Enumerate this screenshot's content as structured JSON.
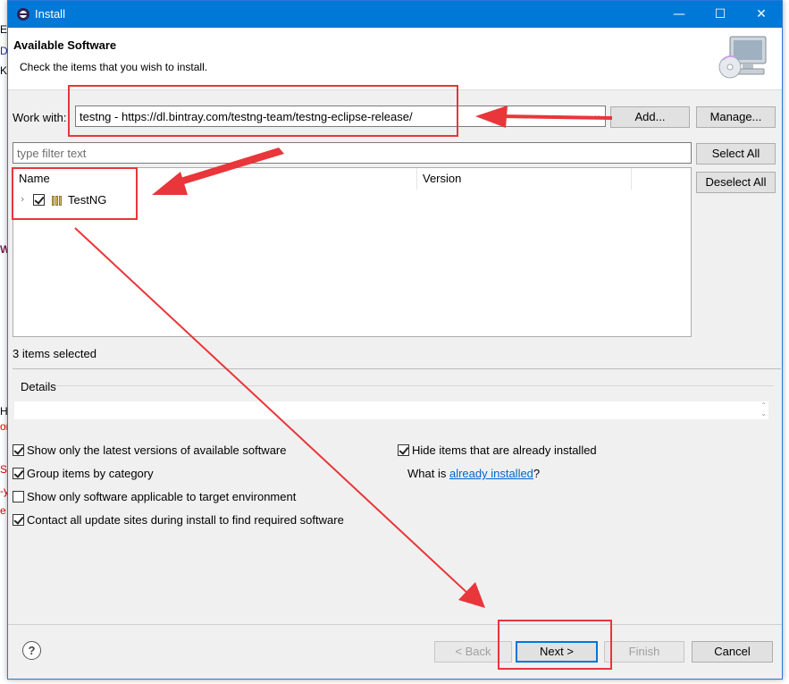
{
  "window": {
    "title": "Install",
    "controls": {
      "minimize": "—",
      "maximize": "☐",
      "close": "✕"
    }
  },
  "banner": {
    "heading": "Available Software",
    "description": "Check the items that you wish to install."
  },
  "work_with": {
    "label": "Work with:",
    "value": "testng - https://dl.bintray.com/testng-team/testng-eclipse-release/",
    "dropdown_glyph": "⌄",
    "add_button": "Add...",
    "manage_button": "Manage..."
  },
  "filter": {
    "placeholder": "type filter text",
    "value": ""
  },
  "side_buttons": {
    "select_all": "Select All",
    "deselect_all": "Deselect All"
  },
  "tree": {
    "columns": [
      "Name",
      "Version"
    ],
    "rows": [
      {
        "expander": "›",
        "checked": true,
        "name": "TestNG",
        "version": ""
      }
    ]
  },
  "status": {
    "selection_count": "3 items selected"
  },
  "details": {
    "label": "Details",
    "text": "",
    "scroll_up": "⌃",
    "scroll_down": "⌄"
  },
  "options": [
    {
      "label": "Show only the latest versions of available software",
      "checked": true
    },
    {
      "label": "Group items by category",
      "checked": true
    },
    {
      "label": "Show only software applicable to target environment",
      "checked": false
    },
    {
      "label": "Contact all update sites during install to find required software",
      "checked": true
    },
    {
      "label": "Hide items that are already installed",
      "checked": true
    }
  ],
  "already_installed": {
    "prefix": "What is ",
    "link": "already installed",
    "suffix": "?"
  },
  "footer": {
    "help": "?",
    "back": "< Back",
    "next": "Next >",
    "finish": "Finish",
    "cancel": "Cancel"
  },
  "background_text": {
    "left_fragments": [
      "E",
      "D",
      "K",
      "W",
      "H",
      "or",
      "SI",
      "-y",
      "e"
    ]
  },
  "colors": {
    "title_bar": "#0078d7",
    "dialog_bg": "#f0f0f0",
    "annotation": "#e8363a",
    "link": "#0066cc"
  }
}
